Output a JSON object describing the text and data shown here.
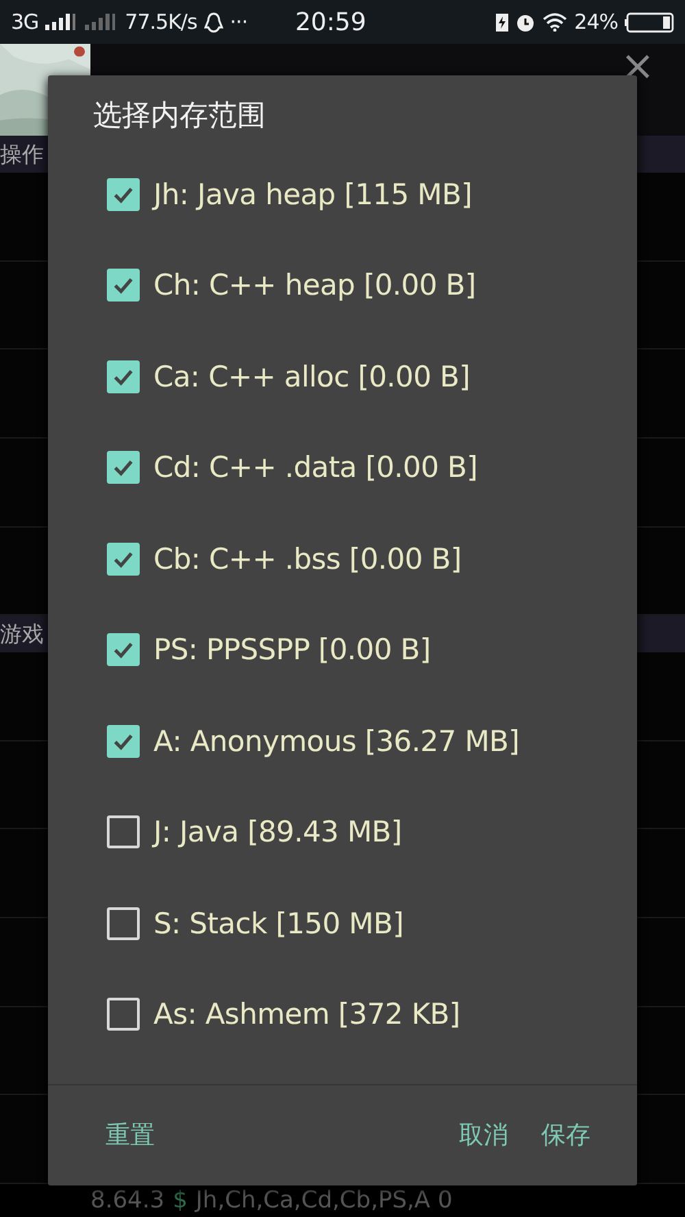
{
  "status_bar": {
    "network": "3G",
    "speed": "77.5K/s",
    "more": "···",
    "time": "20:59",
    "battery": "24%"
  },
  "background": {
    "close": "×",
    "sections": [
      "操作",
      "游戏"
    ],
    "footer": {
      "version": "8.64.3",
      "symbol": "$",
      "ranges": "Jh,Ch,Ca,Cd,Cb,PS,A 0"
    }
  },
  "dialog": {
    "title": "选择内存范围",
    "items": [
      {
        "label": "Jh: Java heap [115 MB]",
        "checked": true
      },
      {
        "label": "Ch: C++ heap [0.00 B]",
        "checked": true
      },
      {
        "label": "Ca: C++ alloc [0.00 B]",
        "checked": true
      },
      {
        "label": "Cd: C++ .data [0.00 B]",
        "checked": true
      },
      {
        "label": "Cb: C++ .bss [0.00 B]",
        "checked": true
      },
      {
        "label": "PS: PPSSPP [0.00 B]",
        "checked": true
      },
      {
        "label": "A: Anonymous [36.27 MB]",
        "checked": true
      },
      {
        "label": "J: Java [89.43 MB]",
        "checked": false
      },
      {
        "label": "S: Stack [150 MB]",
        "checked": false
      },
      {
        "label": "As: Ashmem [372 KB]",
        "checked": false
      }
    ],
    "buttons": {
      "reset": "重置",
      "cancel": "取消",
      "save": "保存"
    }
  }
}
